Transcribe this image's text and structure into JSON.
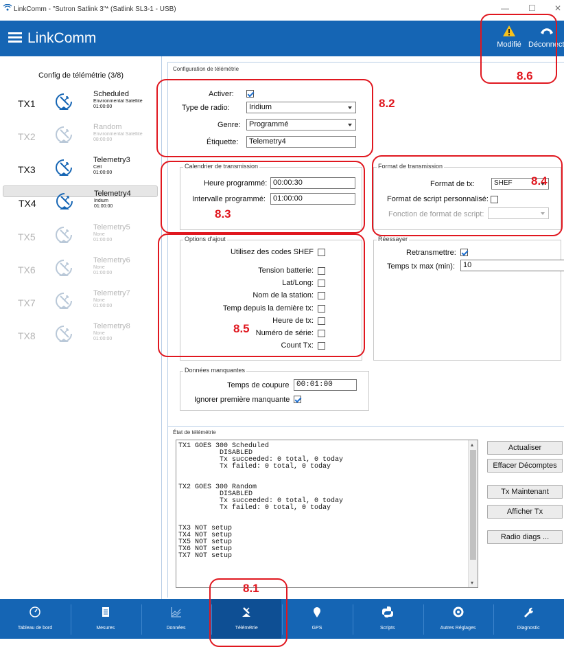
{
  "window": {
    "title": "LinkComm - \"Sutron Satlink 3\"* (Satlink SL3-1 - USB)",
    "minimize": "—",
    "maximize": "☐",
    "close": "✕"
  },
  "header": {
    "app_name": "LinkComm",
    "modified_label": "Modifié",
    "disconnect_label": "Déconnecter"
  },
  "sidebar": {
    "title": "Config de télémétrie (3/8)",
    "items": [
      {
        "tx": "TX1",
        "name": "Scheduled",
        "sub1": "Environmental Satellite",
        "sub2": "01:00:00",
        "enabled": true
      },
      {
        "tx": "TX2",
        "name": "Random",
        "sub1": "Environmental Satellite",
        "sub2": "08:00:00",
        "enabled": false
      },
      {
        "tx": "TX3",
        "name": "Telemetry3",
        "sub1": "Cell",
        "sub2": "01:00:00",
        "enabled": true
      },
      {
        "tx": "TX4",
        "name": "Telemetry4",
        "sub1": "Iridium",
        "sub2": "01:00:00",
        "enabled": true,
        "selected": true
      },
      {
        "tx": "TX5",
        "name": "Telemetry5",
        "sub1": "None",
        "sub2": "01:00:00",
        "enabled": false
      },
      {
        "tx": "TX6",
        "name": "Telemetry6",
        "sub1": "None",
        "sub2": "01:00:00",
        "enabled": false
      },
      {
        "tx": "TX7",
        "name": "Telemetry7",
        "sub1": "None",
        "sub2": "01:00:00",
        "enabled": false
      },
      {
        "tx": "TX8",
        "name": "Telemetry8",
        "sub1": "None",
        "sub2": "01:00:00",
        "enabled": false
      }
    ]
  },
  "config": {
    "section_title": "Configuration de télémétrie",
    "activer_label": "Activer:",
    "activer_checked": true,
    "radio_label": "Type de radio:",
    "radio_value": "Iridium",
    "genre_label": "Genre:",
    "genre_value": "Programmé",
    "etiquette_label": "Étiquette:",
    "etiquette_value": "Telemetry4"
  },
  "schedule": {
    "title": "Calendrier de transmission",
    "time_label": "Heure programmé:",
    "time_value": "00:00:30",
    "interval_label": "Intervalle programmé:",
    "interval_value": "01:00:00"
  },
  "format": {
    "title": "Format de transmission",
    "tx_format_label": "Format de tx:",
    "tx_format_value": "SHEF",
    "custom_label": "Format de script personnalisé:",
    "custom_checked": false,
    "func_label": "Fonction de format de script:",
    "func_value": ""
  },
  "retry": {
    "title": "Réessayer",
    "retransmit_label": "Retransmettre:",
    "retransmit_checked": true,
    "max_label": "Temps tx max (min):",
    "max_value": "10"
  },
  "options": {
    "title": "Options d'ajout",
    "items": [
      {
        "label": "Utilisez des codes SHEF",
        "checked": false
      },
      {
        "label": "Tension batterie:",
        "checked": false
      },
      {
        "label": "Lat/Long:",
        "checked": false
      },
      {
        "label": "Nom de la station:",
        "checked": false
      },
      {
        "label": "Temp depuis la dernière tx:",
        "checked": false
      },
      {
        "label": "Heure de tx:",
        "checked": false
      },
      {
        "label": "Numéro de série:",
        "checked": false
      },
      {
        "label": "Count Tx:",
        "checked": false
      }
    ]
  },
  "missing": {
    "title": "Données manquantes",
    "cutoff_label": "Temps de coupure",
    "cutoff_value": "00:01:00",
    "ignore_label": "Ignorer première manquante",
    "ignore_checked": true
  },
  "status": {
    "title": "État de télémétrie",
    "text": "TX1 GOES 300 Scheduled\n          DISABLED\n          Tx succeeded: 0 total, 0 today\n          Tx failed: 0 total, 0 today\n\n\nTX2 GOES 300 Random\n          DISABLED\n          Tx succeeded: 0 total, 0 today\n          Tx failed: 0 total, 0 today\n\n\nTX3 NOT setup\nTX4 NOT setup\nTX5 NOT setup\nTX6 NOT setup\nTX7 NOT setup",
    "buttons": {
      "refresh": "Actualiser",
      "clear": "Effacer Décomptes",
      "tx_now": "Tx Maintenant",
      "show_tx": "Afficher Tx",
      "radio_diags": "Radio diags ..."
    }
  },
  "annotations": {
    "a81": "8.1",
    "a82": "8.2",
    "a83": "8.3",
    "a84": "8.4",
    "a85": "8.5",
    "a86": "8.6"
  },
  "nav": [
    {
      "label": "Tableau de bord",
      "icon": "dashboard-icon"
    },
    {
      "label": "Mesures",
      "icon": "document-icon"
    },
    {
      "label": "Données",
      "icon": "chart-icon"
    },
    {
      "label": "Télémétrie",
      "icon": "satellite-icon",
      "active": true
    },
    {
      "label": "GPS",
      "icon": "location-pin-icon"
    },
    {
      "label": "Scripts",
      "icon": "python-icon"
    },
    {
      "label": "Autres Réglages",
      "icon": "gear-icon"
    },
    {
      "label": "Diagnostic",
      "icon": "wrench-icon"
    }
  ],
  "colors": {
    "brand": "#1565b4",
    "annotation_red": "#e0171f",
    "check_blue": "#1d6fd0"
  }
}
